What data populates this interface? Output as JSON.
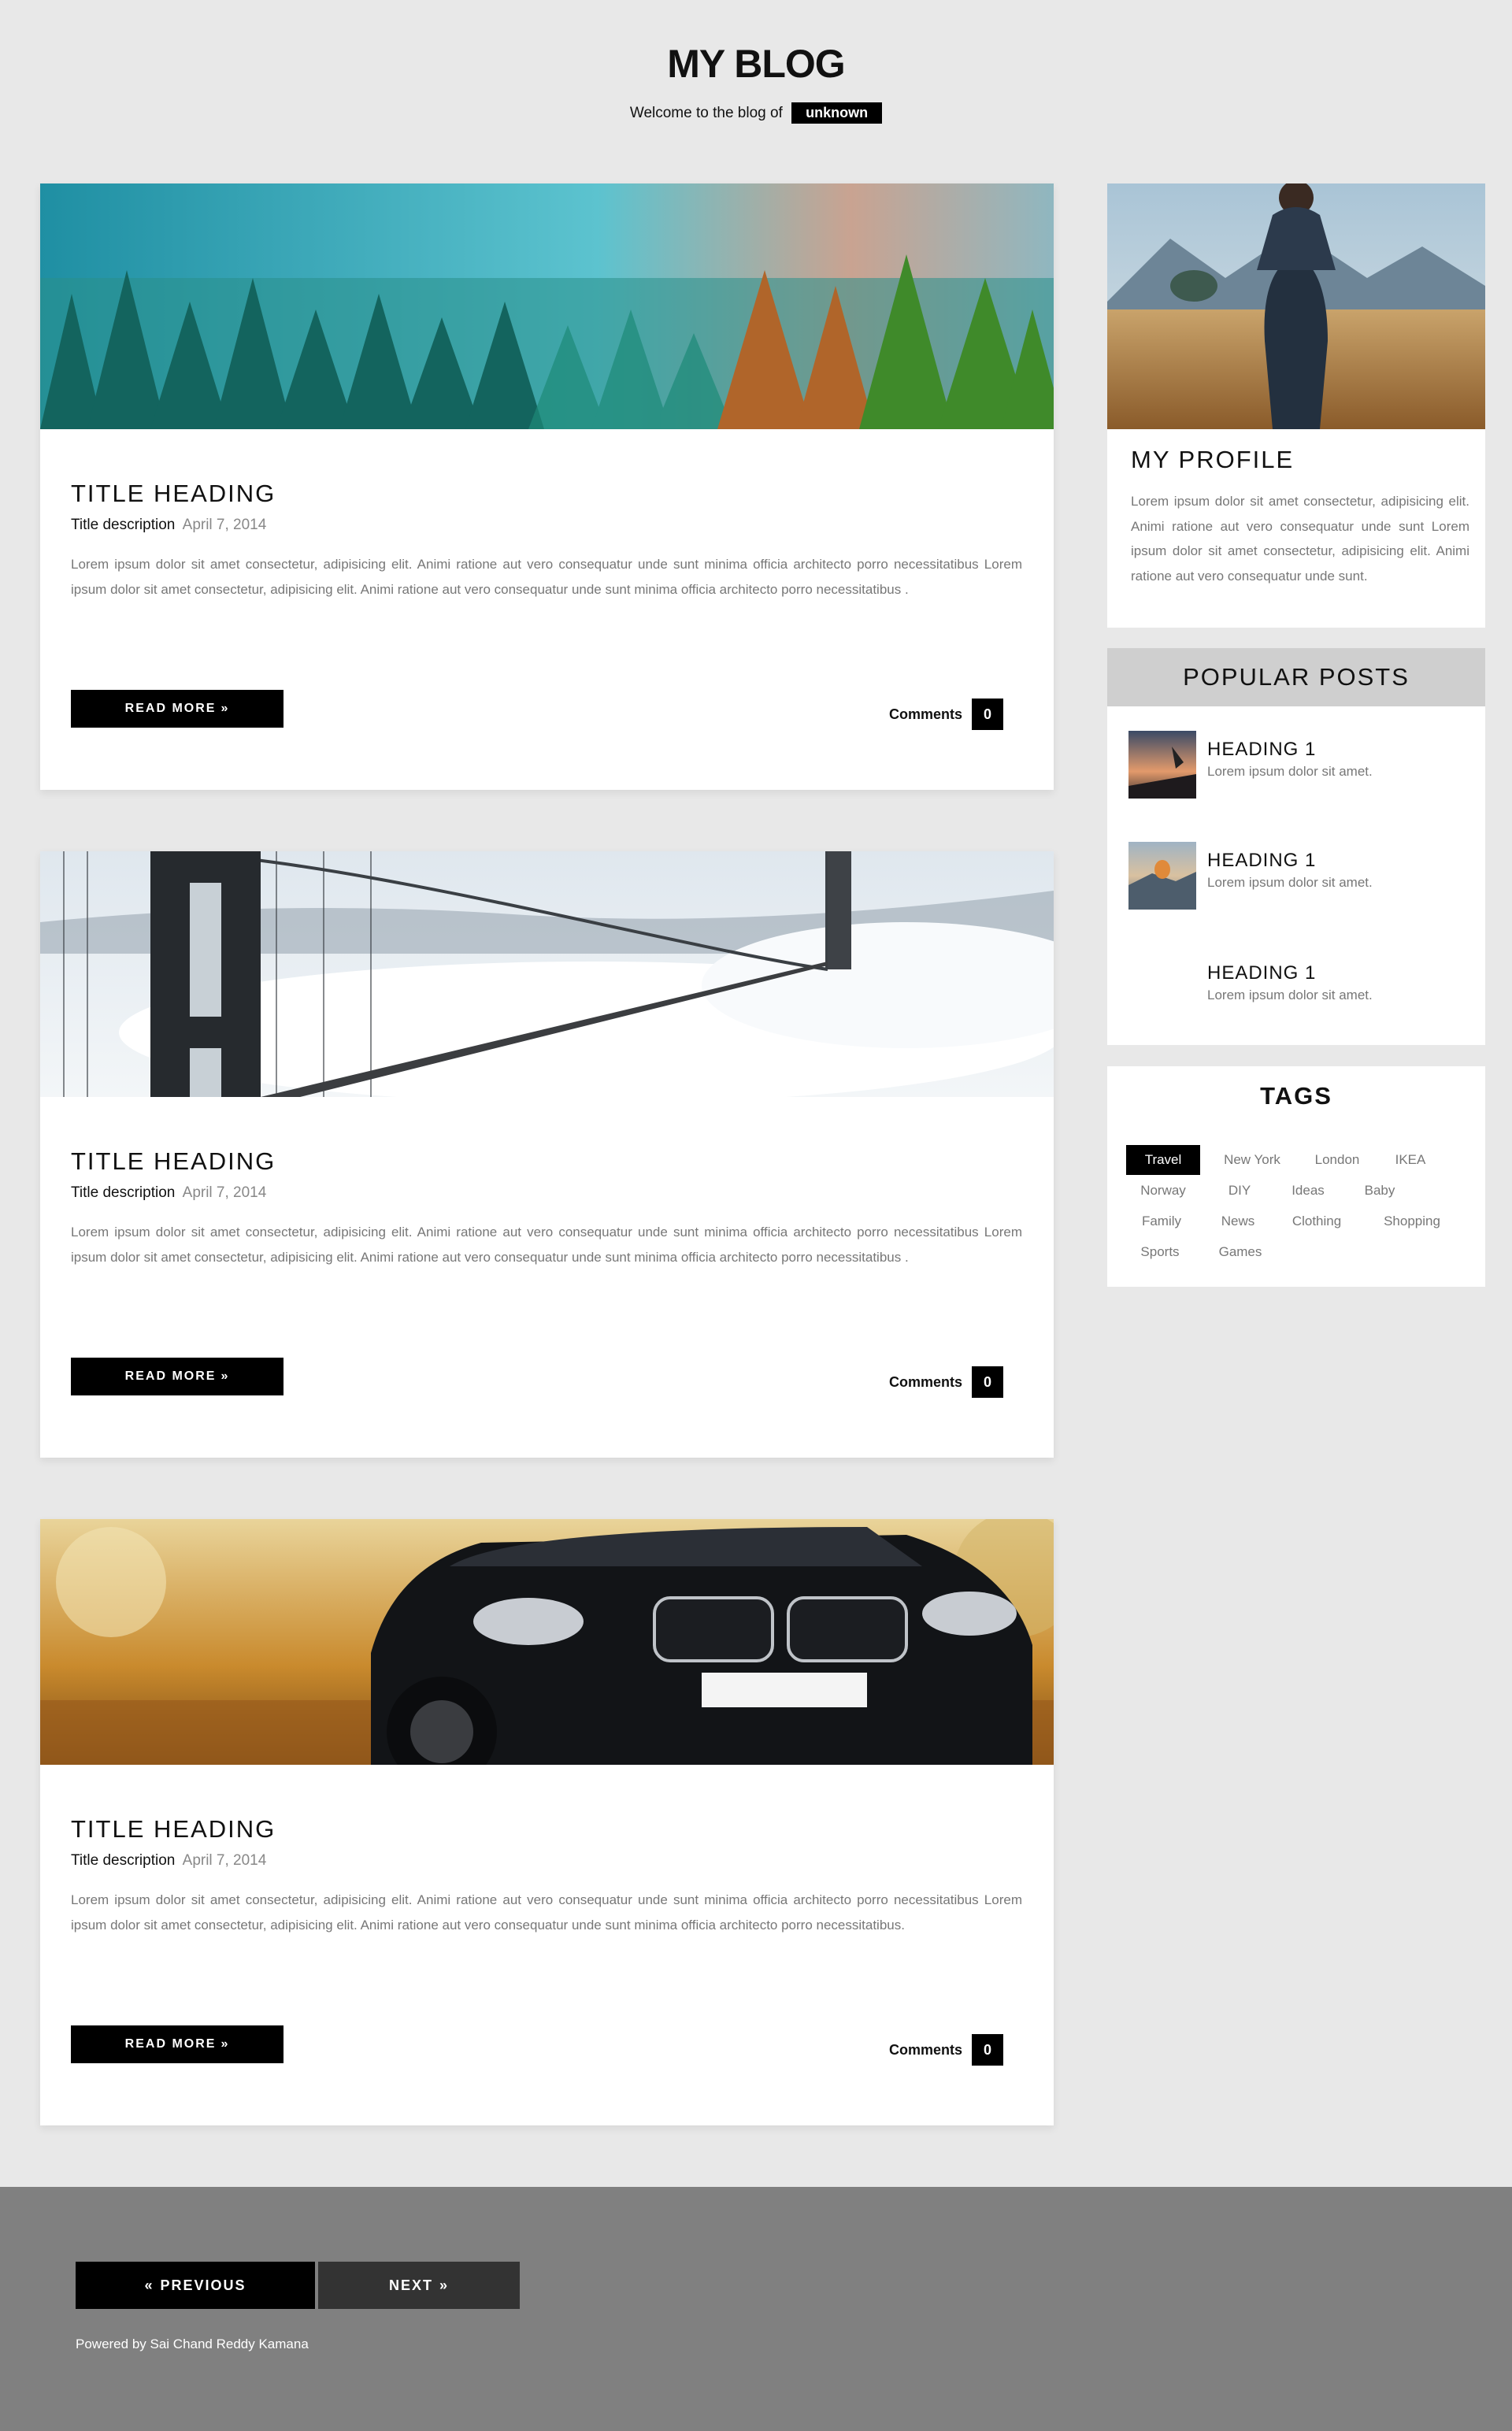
{
  "header": {
    "title": "MY BLOG",
    "tagline": "Welcome to the blog of",
    "owner": "unknown"
  },
  "posts": [
    {
      "image": "forest-photo",
      "title": "TITLE HEADING",
      "meta_label": "Title description",
      "date": "April 7, 2014",
      "body": "Lorem ipsum dolor sit amet consectetur, adipisicing elit. Animi ratione aut vero consequatur unde sunt minima officia architecto porro necessitatibus Lorem ipsum dolor sit amet consectetur, adipisicing elit. Animi ratione aut vero consequatur unde sunt minima officia architecto porro necessitatibus .",
      "read_more": "READ MORE",
      "comments_label": "Comments",
      "comments_count": "0"
    },
    {
      "image": "bridge-photo",
      "title": "TITLE HEADING",
      "meta_label": "Title description",
      "date": "April 7, 2014",
      "body": "Lorem ipsum dolor sit amet consectetur, adipisicing elit. Animi ratione aut vero consequatur unde sunt minima officia architecto porro necessitatibus Lorem ipsum dolor sit amet consectetur, adipisicing elit. Animi ratione aut vero consequatur unde sunt minima officia architecto porro necessitatibus .",
      "read_more": "READ MORE",
      "comments_label": "Comments",
      "comments_count": "0"
    },
    {
      "image": "car-photo",
      "title": "TITLE HEADING",
      "meta_label": "Title description",
      "date": "April 7, 2014",
      "body": "Lorem ipsum dolor sit amet consectetur, adipisicing elit. Animi ratione aut vero consequatur unde sunt minima officia architecto porro necessitatibus Lorem ipsum dolor sit amet consectetur, adipisicing elit. Animi ratione aut vero consequatur unde sunt minima officia architecto porro necessitatibus.",
      "read_more": "READ MORE",
      "comments_label": "Comments",
      "comments_count": "0"
    }
  ],
  "sidebar": {
    "profile": {
      "title": "MY PROFILE",
      "text": "Lorem ipsum dolor sit amet consectetur, adipisicing elit. Animi ratione aut vero consequatur unde sunt Lorem ipsum dolor sit amet consectetur, adipisicing elit. Animi ratione aut vero consequatur unde sunt."
    },
    "popular": {
      "title": "POPULAR POSTS",
      "items": [
        {
          "heading": "HEADING 1",
          "text": "Lorem ipsum dolor sit amet."
        },
        {
          "heading": "HEADING 1",
          "text": "Lorem ipsum dolor sit amet."
        },
        {
          "heading": "HEADING 1",
          "text": "Lorem ipsum dolor sit amet."
        }
      ]
    },
    "tags": {
      "title": "TAGS",
      "items": [
        "Travel",
        "New York",
        "London",
        "IKEA",
        "Norway",
        "DIY",
        "Ideas",
        "Baby",
        "Family",
        "News",
        "Clothing",
        "Shopping",
        "Sports",
        "Games"
      ],
      "active": "Travel"
    }
  },
  "footer": {
    "previous": "PREVIOUS",
    "next": "NEXT",
    "powered": "Powered by Sai Chand Reddy Kamana"
  },
  "colors": {
    "page_bg": "#e8e8e8",
    "accent": "#000000",
    "footer_bg": "#808080"
  }
}
